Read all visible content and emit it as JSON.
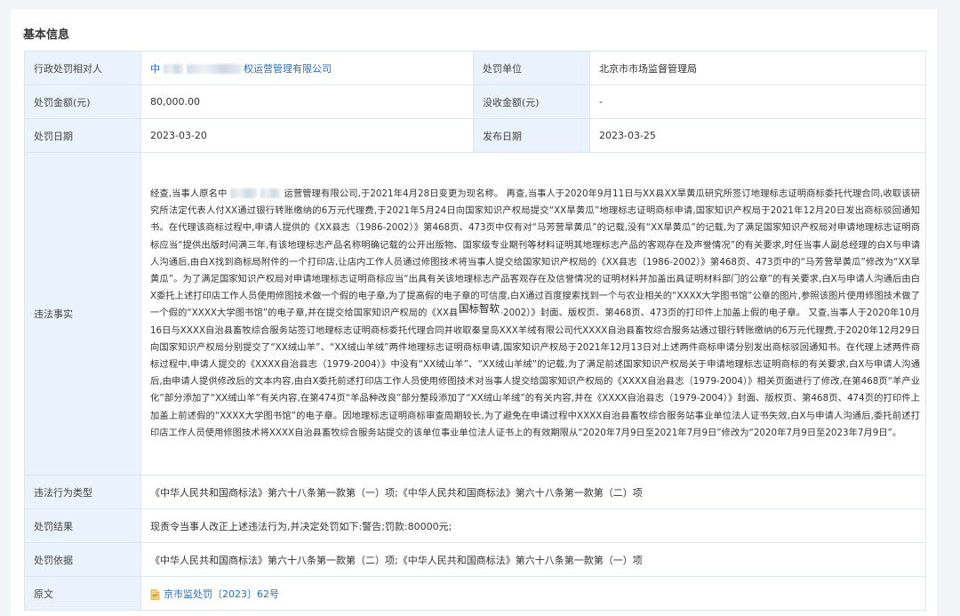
{
  "section": {
    "title": "基本信息"
  },
  "labels": {
    "party": "行政处罚相对人",
    "dept": "处罚单位",
    "amount": "处罚金额(元)",
    "confiscation": "没收金额(元)",
    "penalty_date": "处罚日期",
    "publish_date": "发布日期",
    "facts": "违法事实",
    "violation_type": "违法行为类型",
    "result": "处罚结果",
    "basis": "处罚依据",
    "original": "原文"
  },
  "values": {
    "party_prefix": "中",
    "party_suffix": "权运营管理有限公司",
    "dept": "北京市市场监督管理局",
    "amount": "80,000.00",
    "confiscation": "-",
    "penalty_date": "2023-03-20",
    "publish_date": "2023-03-25",
    "facts_prefix": "经查,当事人原名中",
    "facts_body": "运营管理有限公司,于2021年4月28日变更为现名称。 再查,当事人于2020年9月11日与XX县XX旱黄瓜研究所签订地理标志证明商标委托代理合同,收取该研究所法定代表人付XX通过银行转账缴纳的6万元代理费,于2021年5月24日向国家知识产权局提交“XX旱黄瓜”地理标志证明商标申请,国家知识产权局于2021年12月20日发出商标驳回通知书。在代理该商标过程中,申请人提供的《XX县志（1986-2002）》第468页、473页中仅有对“马芳营旱黄瓜”的记载,没有“XX旱黄瓜”的记载,为了满足国家知识产权局对申请地理标志证明商标应当“提供出版时间满三年,有该地理标志产品名称明确记载的公开出版物、国家级专业期刊等材料证明其地理标志产品的客观存在及声誉情况”的有关要求,时任当事人副总经理的白X与申请人沟通后,由白X找到商标局附件的一个打印店,让店内工作人员通过修图技术将当事人提交给国家知识产权局的《XX县志（1986-2002）》第468页、473页中的“马芳营旱黄瓜”修改为“XX旱黄瓜”。为了满足国家知识产权局对申请地理标志证明商标应当“出具有关该地理标志产品客观存在及信誉情况的证明材料并加盖出具证明材料部门的公章”的有关要求,白X与申请人沟通后由白X委托上述打印店工作人员使用修图技术做一个假的电子章,为了提高假的电子章的可信度,白X通过百度搜索找到一个与农业相关的“XXXX大学图书馆”公章的图片,参照该图片使用修图技术做了一个假的“XXXX大学图书馆”的电子章,并在提交给国家知识产权局的《XX县志（1986-2002）》封面、版权页、第468页、473页的打印件上加盖上假的电子章。 又查,当事人于2020年10月16日与XXXX自治县畜牧综合服务站签订地理标志证明商标委托代理合同并收取秦皇岛XXX羊绒有限公司代XXXX自治县畜牧综合服务站通过银行转账缴纳的6万元代理费,于2020年12月29日向国家知识产权局分别提交了“XX绒山羊”、“XX绒山羊绒”两件地理标志证明商标申请,国家知识产权局于2021年12月13日对上述两件商标申请分别发出商标驳回通知书。在代理上述两件商标过程中,申请人提交的《XXXX自治县志（1979-2004）》中没有“XX绒山羊”、“XX绒山羊绒”的记载,为了满足前述国家知识产权局关于申请地理标志证明商标的有关要求,白X与申请人沟通后,由申请人提供修改后的文本内容,由白X委托前述打印店工作人员使用修图技术对当事人提交给国家知识产权局的《XXXX自治县志（1979-2004）》相关页面进行了修改,在第468页“羊产业化”部分添加了“XX绒山羊”有关内容,在第474页“羊品种改良”部分整段添加了“XX绒山羊绒”的有关内容,并在《XXXX自治县志（1979-2004）》封面、版权页、第468页、474页的打印件上加盖上前述假的“XXXX大学图书馆”的电子章。因地理标志证明商标审查周期较长,为了避免在申请过程中XXXX自治县畜牧综合服务站事业单位法人证书失效,白X与申请人沟通后,委托前述打印店工作人员使用修图技术将XXXX自治县畜牧综合服务站提交的该单位事业单位法人证书上的有效期限从“2020年7月9日至2021年7月9日”修改为“2020年7月9日至2023年7月9日”。",
    "watermark": "国标智软",
    "violation_type": "《中华人民共和国商标法》第六十八条第一款第（一）项;《中华人民共和国商标法》第六十八条第一款第（二）项",
    "result": "现责令当事人改正上述违法行为,并决定处罚如下:警告;罚款:80000元;",
    "basis": "《中华人民共和国商标法》第六十八条第一款第（二）项;《中华人民共和国商标法》第六十八条第一款第（一）项",
    "original_link": "京市监处罚〔2023〕62号"
  },
  "icons": {
    "document": "document-icon"
  },
  "colors": {
    "label_bg": "#eaf3fb",
    "link": "#2a6bc0",
    "border": "#dde6ee"
  }
}
